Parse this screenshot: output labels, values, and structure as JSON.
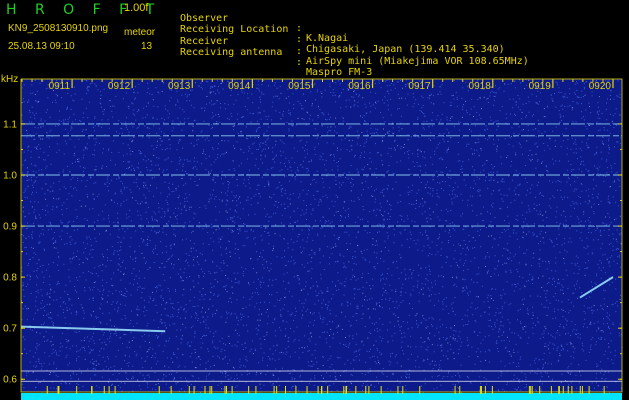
{
  "header": {
    "app_title": "H R O F F T",
    "version": "1.00f",
    "filename": "KN9_2508130910.png",
    "meteor_label": "meteor",
    "timestamp": "25.08.13 09:10",
    "meteor_count": "13",
    "info": [
      {
        "label": "Observer",
        "value": "K.Nagai"
      },
      {
        "label": "Receiving Location",
        "value": "Chigasaki, Japan (139.414 35.340)"
      },
      {
        "label": "Receiver",
        "value": "AirSpy mini (Miakejima VOR 108.65MHz)"
      },
      {
        "label": "Receiving antenna",
        "value": "Maspro FM-3"
      }
    ]
  },
  "chart_data": {
    "type": "heatmap",
    "ylabel": "kHz",
    "x_ticks": [
      "0911",
      "0912",
      "0913",
      "0914",
      "0915",
      "0916",
      "0917",
      "0918",
      "0919",
      "0920"
    ],
    "y_ticks": [
      "1.1",
      "1.0",
      "0.9",
      "0.8",
      "0.7",
      "0.6"
    ],
    "y_tick_values": [
      1.1,
      1.0,
      0.9,
      0.8,
      0.7,
      0.6
    ],
    "ylim": [
      0.575,
      1.188
    ],
    "xlim": [
      0,
      10
    ],
    "persistent_lines_khz": [
      1.1,
      1.077,
      1.0,
      0.9
    ],
    "meteor_echoes": [
      {
        "x_start": 0.0,
        "x_end": 2.4,
        "khz_start": 0.703,
        "khz_end": 0.694
      },
      {
        "x_start": 9.3,
        "x_end": 9.85,
        "khz_start": 0.76,
        "khz_end": 0.8
      }
    ],
    "colors": {
      "background": "#0d1a8a",
      "noise": "#4a6ff0",
      "signal": "#9fe8ff",
      "axis_text": "#e6d400",
      "grid": "#ffffff",
      "marker_bar": "#00e5ff",
      "tick_mark": "#e6d400"
    }
  }
}
